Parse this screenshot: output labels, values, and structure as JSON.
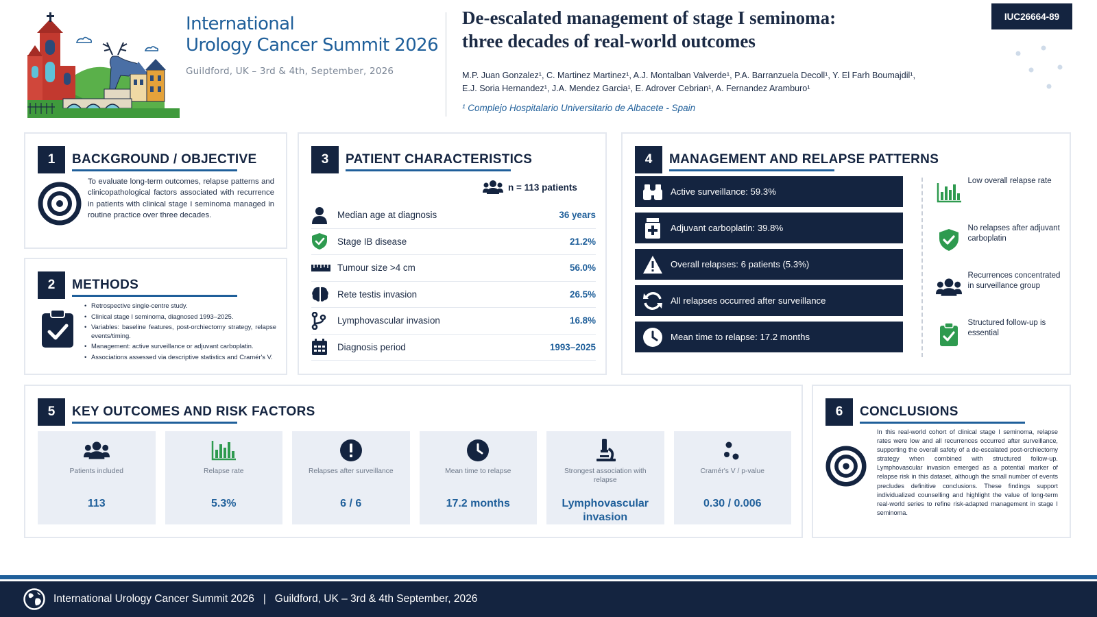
{
  "header": {
    "summit_line1": "International",
    "summit_line2": "Urology Cancer Summit 2026",
    "summit_sub": "Guildford, UK – 3rd & 4th, September, 2026",
    "title_line1": "De-escalated management of stage I seminoma:",
    "title_line2": "three decades of real-world outcomes",
    "authors_line1": "M.P. Juan Gonzalez¹, C. Martinez Martinez¹, A.J. Montalban Valverde¹, P.A. Barranzuela Decoll¹, Y. El Farh Boumajdil¹,",
    "authors_line2": "E.J. Soria Hernandez¹, J.A. Mendez Garcia¹, E. Adrover Cebrian¹, A. Fernandez Aramburo¹",
    "affiliation": "¹ Complejo Hospitalario Universitario de Albacete - Spain",
    "poster_id": "IUC26664-89"
  },
  "background": {
    "number": "1",
    "title": "BACKGROUND / OBJECTIVE",
    "text": "To evaluate long-term outcomes, relapse patterns and clinicopathological factors associated with recurrence in patients with clinical stage I seminoma managed in routine practice over three decades."
  },
  "methods": {
    "number": "2",
    "title": "METHODS",
    "items": [
      "Retrospective single-centre study.",
      "Clinical stage I seminoma, diagnosed 1993–2025.",
      "Variables: baseline features, post-orchiectomy strategy, relapse events/timing.",
      "Management: active surveillance or adjuvant carboplatin.",
      "Associations assessed via descriptive statistics and Cramér's V."
    ]
  },
  "patients": {
    "number": "3",
    "title": "PATIENT CHARACTERISTICS",
    "n_label": "n = 113 patients",
    "rows": [
      {
        "icon": "person-icon",
        "label": "Median age at diagnosis",
        "value": "36 years"
      },
      {
        "icon": "shield-check-icon",
        "label": "Stage IB disease",
        "value": "21.2%"
      },
      {
        "icon": "ruler-icon",
        "label": "Tumour size >4 cm",
        "value": "56.0%"
      },
      {
        "icon": "brain-icon",
        "label": "Rete testis invasion",
        "value": "26.5%"
      },
      {
        "icon": "branch-icon",
        "label": "Lymphovascular invasion",
        "value": "16.8%"
      },
      {
        "icon": "calendar-icon",
        "label": "Diagnosis period",
        "value": "1993–2025"
      }
    ]
  },
  "management": {
    "number": "4",
    "title": "MANAGEMENT AND RELAPSE PATTERNS",
    "bars": [
      {
        "icon": "binoculars-icon",
        "label": "Active surveillance: 59.3%"
      },
      {
        "icon": "medicine-icon",
        "label": "Adjuvant carboplatin: 39.8%"
      },
      {
        "icon": "warning-icon",
        "label": "Overall relapses: 6 patients (5.3%)"
      },
      {
        "icon": "refresh-icon",
        "label": "All relapses occurred after surveillance"
      },
      {
        "icon": "clock-icon",
        "label": "Mean time to relapse: 17.2 months"
      }
    ],
    "findings": [
      {
        "icon": "bar-chart-icon",
        "label": "Low overall relapse rate"
      },
      {
        "icon": "shield-check-icon",
        "label": "No relapses after adjuvant carboplatin"
      },
      {
        "icon": "group-icon",
        "label": "Recurrences concentrated in surveillance group"
      },
      {
        "icon": "clipboard-check-icon",
        "label": "Structured follow-up is essential"
      }
    ]
  },
  "outcomes": {
    "number": "5",
    "title": "KEY OUTCOMES AND RISK FACTORS",
    "kpis": [
      {
        "icon": "group-icon",
        "label": "Patients included",
        "value": "113"
      },
      {
        "icon": "bar-chart-icon",
        "label": "Relapse rate",
        "value": "5.3%"
      },
      {
        "icon": "alert-icon",
        "label": "Relapses after surveillance",
        "value": "6 / 6"
      },
      {
        "icon": "clock-icon",
        "label": "Mean time to relapse",
        "value": "17.2 months"
      },
      {
        "icon": "microscope-icon",
        "label": "Strongest association with relapse",
        "value": "Lymphovascular invasion"
      },
      {
        "icon": "dots-icon",
        "label": "Cramér's V / p-value",
        "value": "0.30 / 0.006"
      }
    ]
  },
  "conclusions": {
    "number": "6",
    "title": "CONCLUSIONS",
    "text": "In this real-world cohort of clinical stage I seminoma, relapse rates were low and all recurrences occurred after surveillance, supporting the overall safety of a de-escalated post-orchiectomy strategy when combined with structured follow-up. Lymphovascular invasion emerged as a potential marker of relapse risk in this dataset, although the small number of events precludes definitive conclusions. These findings support individualized counselling and highlight the value of long-term real-world series to refine risk-adapted management in stage I seminoma."
  },
  "footer": {
    "text": "International Urology Cancer Summit 2026   |   Guildford, UK – 3rd & 4th September, 2026"
  },
  "colors": {
    "navy": "#142440",
    "blue": "#1f5f9a",
    "green": "#2e9a4f",
    "panel_border": "#e4e8ef",
    "kpi_bg": "#eaeef5"
  }
}
